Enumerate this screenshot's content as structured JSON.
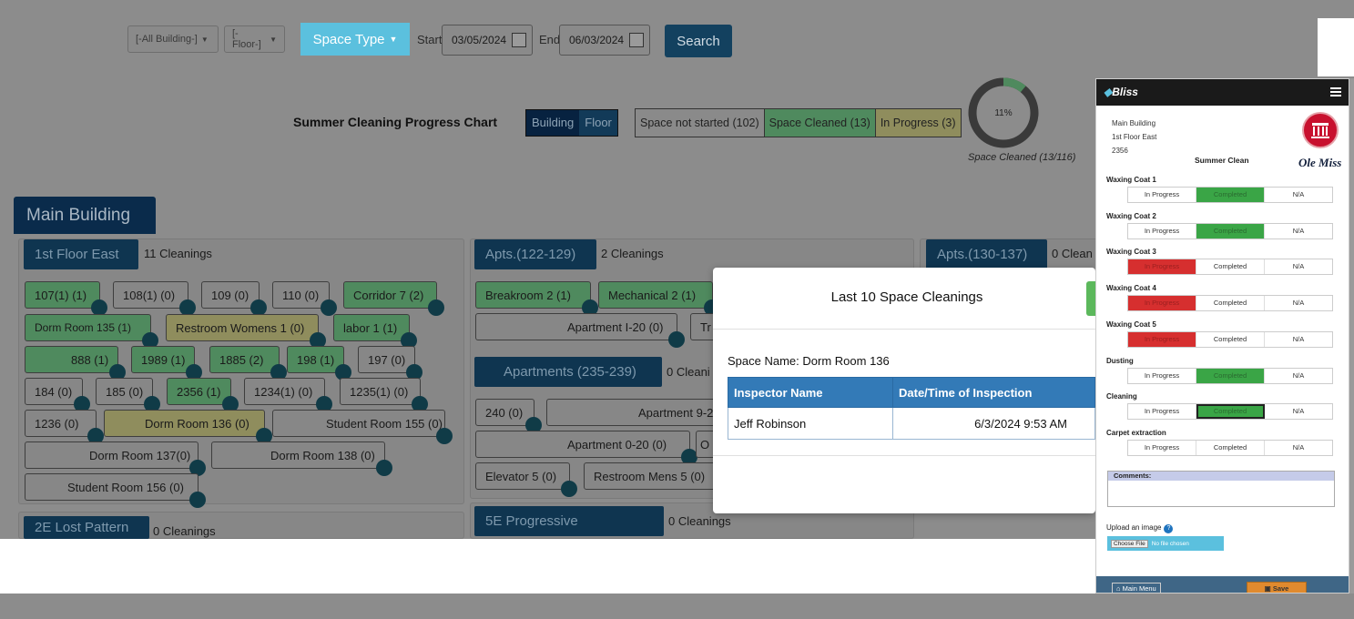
{
  "filters": {
    "building": "[-All Building-]",
    "floor": "[-Floor-]",
    "space_type": "Space Type",
    "start_label": "Start",
    "start_date": "03/05/2024",
    "end_label": "End",
    "end_date": "06/03/2024",
    "search": "Search"
  },
  "chart": {
    "title": "Summer Cleaning Progress Chart",
    "toggle": [
      "Building",
      "Floor"
    ],
    "legend": [
      "Space not started (102)",
      "Space Cleaned (13)",
      "In Progress (3)"
    ],
    "percent": "11%",
    "caption": "Space Cleaned (13/116)",
    "fraction": 0.11
  },
  "building": {
    "name": "Main Building",
    "groups": [
      {
        "name": "1st Floor East",
        "count": "11 Cleanings"
      },
      {
        "name": "Apts.(122-129)",
        "count": "2 Cleanings"
      },
      {
        "name": "Apts.(130-137)",
        "count": "0 Clean"
      },
      {
        "name": "Apartments (235-239)",
        "count": "0 Cleani"
      },
      {
        "name": "2E Lost Pattern",
        "count": "0 Cleanings"
      },
      {
        "name": "5E Progressive",
        "count": "0 Cleanings"
      }
    ],
    "rooms": [
      "107(1) (1)",
      "108(1) (0)",
      "109 (0)",
      "110 (0)",
      "Corridor 7 (2)",
      "Dorm Room 135 (1)",
      "Restroom Womens 1 (0)",
      "labor 1 (1)",
      "888 (1)",
      "1989 (1)",
      "1885 (2)",
      "198 (1)",
      "197 (0)",
      "184 (0)",
      "185 (0)",
      "2356 (1)",
      "1234(1) (0)",
      "1235(1) (0)",
      "1236 (0)",
      "Dorm Room 136 (0)",
      "Student Room 155 (0)",
      "Dorm Room 137(0)",
      "Dorm Room 138 (0)",
      "Student Room 156 (0)",
      "Breakroom 2 (1)",
      "Mechanical 2 (1)",
      "Apartment I-20 (0)",
      "Tr",
      "240 (0)",
      "Apartment 9-2",
      "Apartment 0-20 (0)",
      "O",
      "Elevator 5 (0)",
      "Restroom Mens 5 (0)"
    ]
  },
  "modal": {
    "title": "Last 10 Space Cleanings",
    "space_label": "Space Name:",
    "space_name": "Dorm Room 136",
    "columns": [
      "Inspector Name",
      "Date/Time of Inspection"
    ],
    "rows": [
      [
        "Jeff Robinson",
        "6/3/2024 9:53 AM"
      ]
    ]
  },
  "mobile": {
    "brand": "Bliss",
    "address": [
      "Main Building",
      "1st Floor East",
      "2356"
    ],
    "title": "Summer Clean",
    "logo_text": "Ole Miss",
    "options": [
      "In Progress",
      "Completed",
      "N/A"
    ],
    "tasks": [
      {
        "label": "Waxing Coat 1",
        "state": "Completed"
      },
      {
        "label": "Waxing Coat 2",
        "state": "Completed"
      },
      {
        "label": "Waxing Coat 3",
        "state": "In Progress"
      },
      {
        "label": "Waxing Coat 4",
        "state": "In Progress"
      },
      {
        "label": "Waxing Coat 5",
        "state": "In Progress"
      },
      {
        "label": "Dusting",
        "state": "Completed"
      },
      {
        "label": "Cleaning",
        "state": "Completed"
      },
      {
        "label": "Carpet extraction",
        "state": ""
      }
    ],
    "comments_label": "Comments:",
    "upload_label": "Upload an image",
    "choose_file": "Choose File",
    "no_file": "No file chosen",
    "main_menu": "Main Menu",
    "save": "Save"
  },
  "colors": {
    "accent": "#5bc0de",
    "header_navy": "#0a2b4b",
    "completed_green": "#3aa546",
    "in_progress_red": "#d62f2f"
  }
}
